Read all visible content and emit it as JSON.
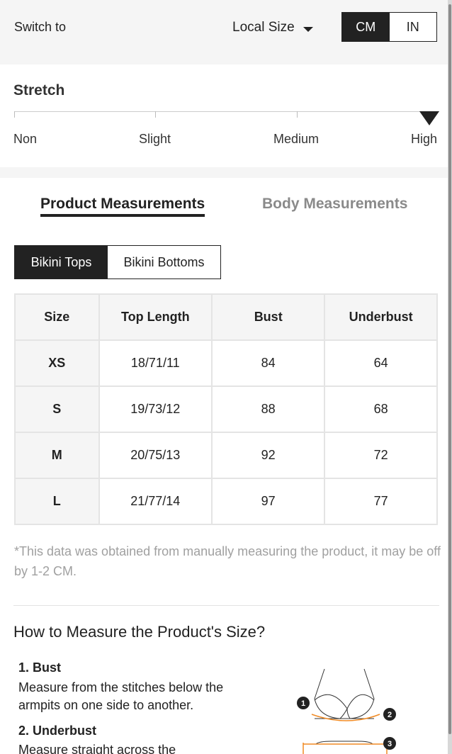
{
  "topbar": {
    "switch_label": "Switch to",
    "local_size": "Local Size",
    "units": [
      "CM",
      "IN"
    ],
    "active_unit": "CM"
  },
  "stretch": {
    "title": "Stretch",
    "levels": [
      "Non",
      "Slight",
      "Medium",
      "High"
    ],
    "selected": "High"
  },
  "tabs": {
    "product": "Product Measurements",
    "body": "Body Measurements",
    "active": "product"
  },
  "categories": {
    "tops": "Bikini Tops",
    "bottoms": "Bikini Bottoms",
    "active": "tops"
  },
  "table": {
    "headers": [
      "Size",
      "Top Length",
      "Bust",
      "Underbust"
    ],
    "rows": [
      [
        "XS",
        "18/71/11",
        "84",
        "64"
      ],
      [
        "S",
        "19/73/12",
        "88",
        "68"
      ],
      [
        "M",
        "20/75/13",
        "92",
        "72"
      ],
      [
        "L",
        "21/77/14",
        "97",
        "77"
      ]
    ]
  },
  "note": "*This data was obtained from manually measuring the product, it may be off by 1-2 CM.",
  "howto": {
    "title": "How to Measure the Product's Size?",
    "steps": [
      {
        "title": "1. Bust",
        "desc": "Measure from the stitches below the armpits on one side to another."
      },
      {
        "title": "2. Underbust",
        "desc": "Measure straight across the"
      }
    ],
    "markers": [
      "1",
      "2",
      "3"
    ]
  },
  "colors": {
    "dark": "#222222",
    "muted": "#8a8a8a",
    "panel": "#f5f5f5",
    "accent_orange": "#f08a24"
  }
}
